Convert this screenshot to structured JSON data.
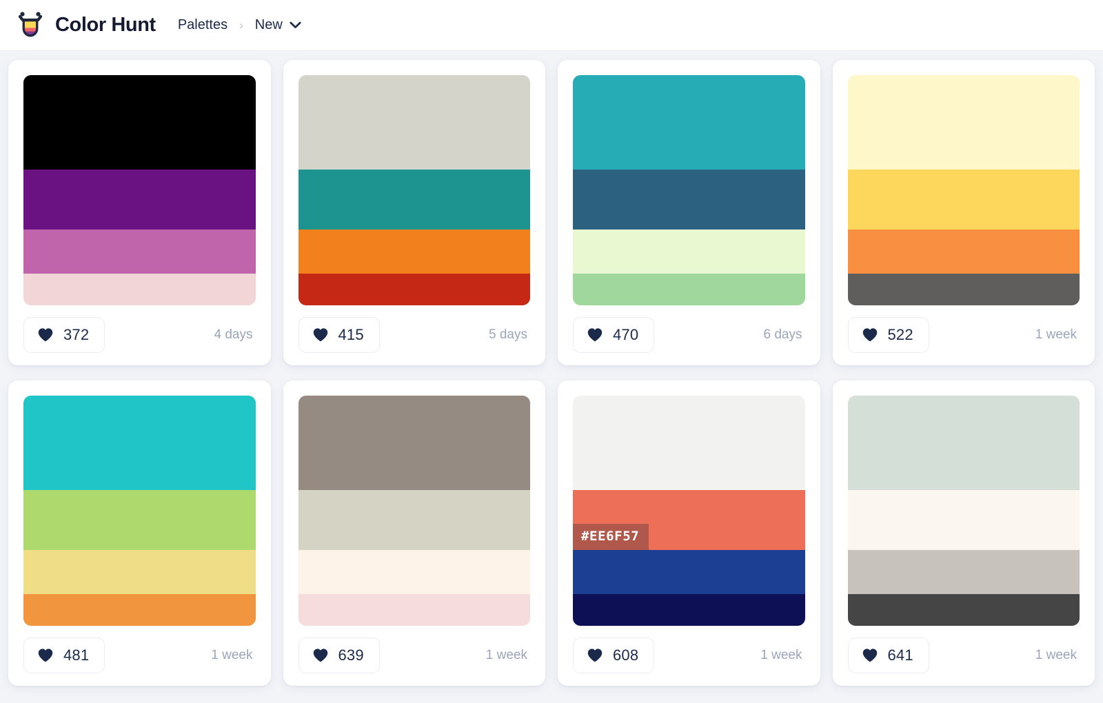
{
  "header": {
    "brand_name": "Color Hunt",
    "logo_icon": "colorhunt-logo-icon",
    "breadcrumb": {
      "root_label": "Palettes",
      "separator": "›",
      "current_label": "New",
      "dropdown_icon": "chevron-down-icon"
    }
  },
  "colors": {
    "page_background": "#F2F4F8",
    "card_background": "#FFFFFF",
    "text_primary": "#1B2A4A",
    "text_muted": "#9AA5BB",
    "heart_fill": "#1B2A4A",
    "tooltip_text": "#FFFFFF"
  },
  "labels": {
    "heart_icon": "heart-icon"
  },
  "palettes": [
    {
      "likes": "372",
      "age": "4 days",
      "swatches": [
        "#000000",
        "#6A1282",
        "#C065AC",
        "#F2D5D7"
      ],
      "tooltip": null
    },
    {
      "likes": "415",
      "age": "5 days",
      "swatches": [
        "#D4D4CB",
        "#1D9490",
        "#F2811D",
        "#C62816"
      ],
      "tooltip": null
    },
    {
      "likes": "470",
      "age": "6 days",
      "swatches": [
        "#26ACB5",
        "#2C6180",
        "#E9F8D0",
        "#9FD79C"
      ],
      "tooltip": null
    },
    {
      "likes": "522",
      "age": "1 week",
      "swatches": [
        "#FDF7C9",
        "#FCD75C",
        "#F98F40",
        "#605E5C"
      ],
      "tooltip": null
    },
    {
      "likes": "481",
      "age": "1 week",
      "swatches": [
        "#20C5C7",
        "#AEDA6D",
        "#EFDD88",
        "#F1953E"
      ],
      "tooltip": null
    },
    {
      "likes": "639",
      "age": "1 week",
      "swatches": [
        "#968B83",
        "#D5D3C4",
        "#FDF3E9",
        "#F7DCDD"
      ],
      "tooltip": null
    },
    {
      "likes": "608",
      "age": "1 week",
      "swatches": [
        "#F2F2F1",
        "#EE6F57",
        "#1C3F94",
        "#0D1055"
      ],
      "tooltip": {
        "index": 1,
        "text": "#EE6F57"
      }
    },
    {
      "likes": "641",
      "age": "1 week",
      "swatches": [
        "#D4DFD7",
        "#FBF7F0",
        "#C7C3BC",
        "#454545"
      ],
      "tooltip": null
    }
  ]
}
